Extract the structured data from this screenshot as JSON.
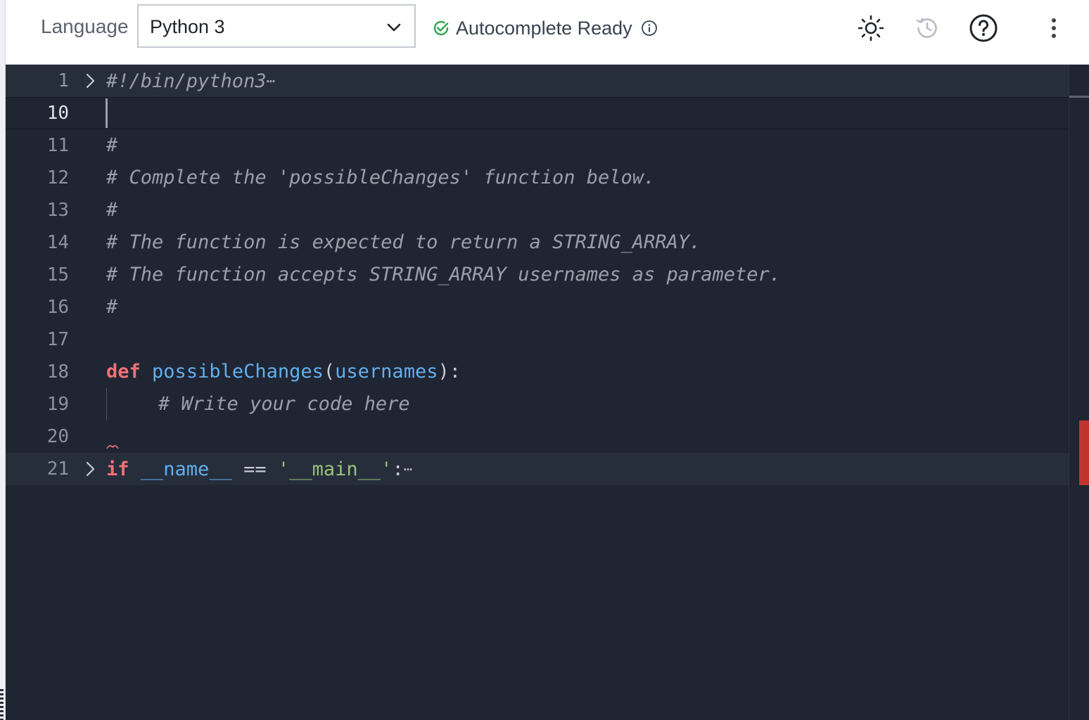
{
  "toolbar": {
    "language_label": "Language",
    "language_value": "Python 3",
    "autocomplete_status": "Autocomplete Ready",
    "icons": [
      "chevron-down-icon",
      "check-circle-icon",
      "info-icon",
      "sun-icon",
      "history-icon",
      "help-icon",
      "more-vertical-icon"
    ]
  },
  "editor": {
    "colors": {
      "background": "#1f2532",
      "comment": "#9aa0ab",
      "keyword": "#f07178",
      "function": "#61afef",
      "string": "#98c379",
      "error_marker": "#c2352f"
    },
    "lines": [
      {
        "num": "1",
        "folded": true,
        "tokens": {
          "c1": "#!/bin/python3"
        }
      },
      {
        "num": "10",
        "current": true
      },
      {
        "num": "11",
        "tokens": {
          "c1": "#"
        }
      },
      {
        "num": "12",
        "tokens": {
          "c1": "# Complete the 'possibleChanges' function below."
        }
      },
      {
        "num": "13",
        "tokens": {
          "c1": "#"
        }
      },
      {
        "num": "14",
        "tokens": {
          "c1": "# The function is expected to return a STRING_ARRAY."
        }
      },
      {
        "num": "15",
        "tokens": {
          "c1": "# The function accepts STRING_ARRAY usernames as parameter."
        }
      },
      {
        "num": "16",
        "tokens": {
          "c1": "#"
        }
      },
      {
        "num": "17"
      },
      {
        "num": "18",
        "tokens": {
          "kw": "def",
          "fn": "possibleChanges",
          "p1": "(",
          "pm": "usernames",
          "p2": "):"
        }
      },
      {
        "num": "19",
        "tokens": {
          "c1": "# Write your code here"
        }
      },
      {
        "num": "20"
      },
      {
        "num": "21",
        "folded": true,
        "tokens": {
          "kw": "if",
          "name": "__name__",
          "op": "==",
          "st": "'__main__'",
          "colon": ":"
        }
      }
    ]
  }
}
